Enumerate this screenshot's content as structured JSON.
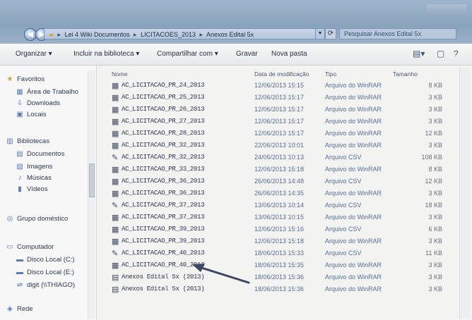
{
  "address": {
    "crumbs": [
      "Lei 4 Wiki Documentos",
      "LICITACOES_2013",
      "Anexos Edital 5x"
    ],
    "search_placeholder": "Pesquisar Anexos Edital 5x"
  },
  "toolbar": {
    "organize": "Organizar ▾",
    "include": "Incluir na biblioteca ▾",
    "share": "Compartilhar com ▾",
    "burn": "Gravar",
    "new_folder": "Nova pasta"
  },
  "nav": {
    "favorites_header": "Favoritos",
    "favorites": [
      "Área de Trabalho",
      "Downloads",
      "Locais"
    ],
    "libraries_header": "Bibliotecas",
    "libraries": [
      "Documentos",
      "Imagens",
      "Músicas",
      "Vídeos"
    ],
    "homegroup": "Grupo doméstico",
    "computer_header": "Computador",
    "drives": [
      "Disco Local (C:)",
      "Disco Local (E:)",
      "digit (\\\\THIAGO)"
    ],
    "network": "Rede"
  },
  "columns": {
    "name": "Nome",
    "date": "Data de modificação",
    "type": "Tipo",
    "size": "Tamanho"
  },
  "files": [
    {
      "icon": "word-doc-icon",
      "name": "AC_LICITACAO_PR_24_2013",
      "date": "12/06/2013 15:15",
      "type": "Arquivo do WinRAR",
      "size": "8 KB"
    },
    {
      "icon": "word-doc-icon",
      "name": "AC_LICITACAO_PR_25_2013",
      "date": "12/06/2013 15:17",
      "type": "Arquivo do WinRAR",
      "size": "3 KB"
    },
    {
      "icon": "word-doc-icon",
      "name": "AC_LICITACAO_PR_26_2013",
      "date": "12/06/2013 15:17",
      "type": "Arquivo do WinRAR",
      "size": "3 KB"
    },
    {
      "icon": "word-doc-icon",
      "name": "AC_LICITACAO_PR_27_2013",
      "date": "12/06/2013 15:17",
      "type": "Arquivo do WinRAR",
      "size": "3 KB"
    },
    {
      "icon": "word-doc-icon",
      "name": "AC_LICITACAO_PR_28_2013",
      "date": "12/06/2013 15:17",
      "type": "Arquivo do WinRAR",
      "size": "12 KB"
    },
    {
      "icon": "word-doc-icon",
      "name": "AC_LICITACAO_PR_32_2013",
      "date": "22/06/2013 10:01",
      "type": "Arquivo do WinRAR",
      "size": "3 KB"
    },
    {
      "icon": "txt-icon",
      "name": "AC_LICITACAO_PR_32_2013",
      "date": "24/06/2013 10:13",
      "type": "Arquivo CSV",
      "size": "108 KB"
    },
    {
      "icon": "word-doc-icon",
      "name": "AC_LICITACAO_PR_33_2013",
      "date": "12/06/2013 15:18",
      "type": "Arquivo do WinRAR",
      "size": "8 KB"
    },
    {
      "icon": "word-doc-icon",
      "name": "AC_LICITACAO_PR_36_2013",
      "date": "26/06/2013 14:48",
      "type": "Arquivo CSV",
      "size": "12 KB"
    },
    {
      "icon": "word-doc-icon",
      "name": "AC_LICITACAO_PR_36_2013",
      "date": "26/06/2013 14:35",
      "type": "Arquivo do WinRAR",
      "size": "3 KB"
    },
    {
      "icon": "txt-icon",
      "name": "AC_LICITACAO_PR_37_2013",
      "date": "13/06/2013 10:14",
      "type": "Arquivo CSV",
      "size": "18 KB"
    },
    {
      "icon": "word-doc-icon",
      "name": "AC_LICITACAO_PR_37_2013",
      "date": "13/06/2013 10:15",
      "type": "Arquivo do WinRAR",
      "size": "3 KB"
    },
    {
      "icon": "word-doc-icon",
      "name": "AC_LICITACAO_PR_39_2013",
      "date": "12/06/2013 15:16",
      "type": "Arquivo CSV",
      "size": "6 KB"
    },
    {
      "icon": "word-doc-icon",
      "name": "AC_LICITACAO_PR_39_2013",
      "date": "12/06/2013 15:18",
      "type": "Arquivo do WinRAR",
      "size": "3 KB"
    },
    {
      "icon": "txt-icon",
      "name": "AC_LICITACAO_PR_40_2013",
      "date": "18/06/2013 15:33",
      "type": "Arquivo CSV",
      "size": "11 KB"
    },
    {
      "icon": "word-doc-icon",
      "name": "AC_LICITACAO_PR_40_2013",
      "date": "18/06/2013 15:35",
      "type": "Arquivo do WinRAR",
      "size": "3 KB"
    },
    {
      "icon": "winrar-icon",
      "name": "Anexos Edital 5x (2013)",
      "date": "18/06/2013 15:36",
      "type": "Arquivo do WinRAR",
      "size": "3 KB"
    },
    {
      "icon": "winrar-icon",
      "name": "Anexos Edital 5x (2013)",
      "date": "18/06/2013 15:36",
      "type": "Arquivo do WinRAR",
      "size": "3 KB"
    }
  ]
}
